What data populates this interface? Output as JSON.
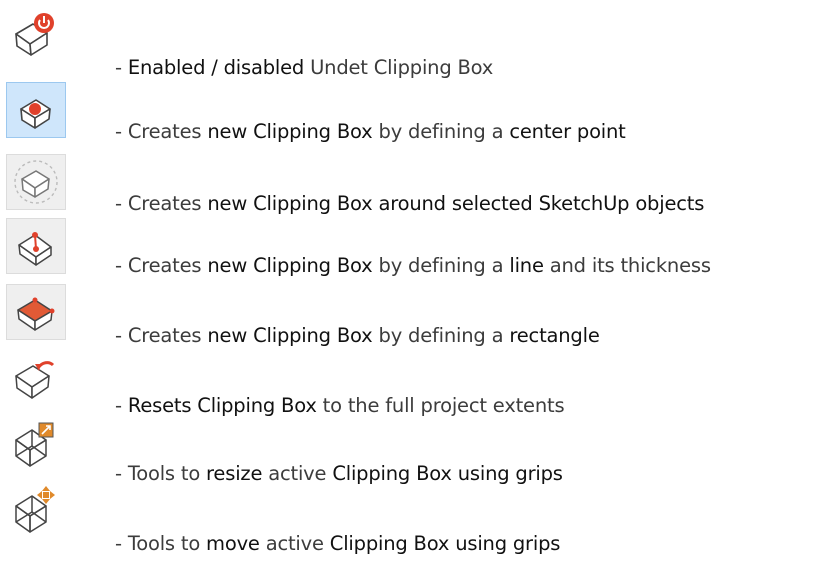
{
  "items": [
    {
      "icon": "toggle-clipping-box-icon",
      "parts": [
        "- ",
        "Enabled / disabled",
        " Undet Clipping Box"
      ]
    },
    {
      "icon": "center-point-box-icon",
      "parts": [
        "- Creates ",
        "new Clipping Box",
        " by defining a ",
        "center point"
      ]
    },
    {
      "icon": "selection-box-icon",
      "parts": [
        "- Creates ",
        "new Clipping Box around selected SketchUp objects"
      ]
    },
    {
      "icon": "line-box-icon",
      "parts": [
        "- Creates ",
        "new Clipping Box",
        " by defining a ",
        "line",
        " and its thickness"
      ]
    },
    {
      "icon": "rectangle-box-icon",
      "parts": [
        "- Creates ",
        "new Clipping Box",
        " by defining a ",
        "rectangle"
      ]
    },
    {
      "icon": "reset-box-icon",
      "parts": [
        "- ",
        "Resets Clipping Box",
        " to the full project extents"
      ]
    },
    {
      "icon": "resize-grips-icon",
      "parts": [
        "- Tools to ",
        "resize",
        " active ",
        "Clipping Box using grips"
      ]
    },
    {
      "icon": "move-grips-icon",
      "parts": [
        "- Tools to ",
        "move",
        " active ",
        "Clipping Box using grips"
      ]
    }
  ],
  "colors": {
    "accent": "#e0412b",
    "icon_bg": "#efefef",
    "icon_active_bg": "#cfe6fb"
  }
}
